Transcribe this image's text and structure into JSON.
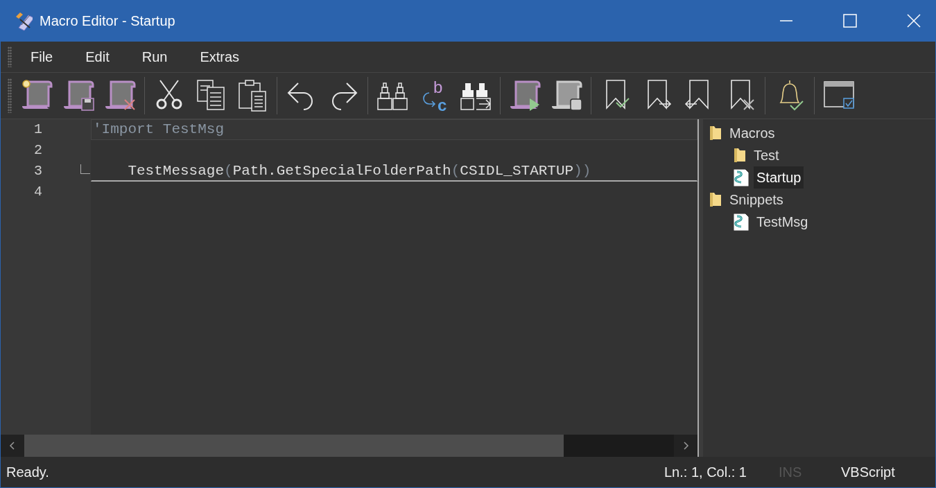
{
  "window": {
    "title": "Macro Editor - Startup"
  },
  "menu": [
    "File",
    "Edit",
    "Run",
    "Extras"
  ],
  "toolbar": {
    "replace_glyphs": [
      "b",
      "c"
    ]
  },
  "editor": {
    "lines": [
      {
        "number": "1",
        "current": true,
        "fold_end": false,
        "tokens": [
          {
            "text": "'Import TestMsg",
            "kind": "comment"
          }
        ]
      },
      {
        "number": "2",
        "current": false,
        "fold_end": false
      },
      {
        "number": "3",
        "current": false,
        "fold_end": true,
        "tokens": [
          {
            "text": "    TestMessage",
            "kind": "ident"
          },
          {
            "text": "(",
            "kind": "paren"
          },
          {
            "text": "Path.GetSpecialFolderPath",
            "kind": "ident"
          },
          {
            "text": "(",
            "kind": "paren"
          },
          {
            "text": "CSIDL_STARTUP",
            "kind": "ident"
          },
          {
            "text": "))",
            "kind": "paren"
          }
        ]
      },
      {
        "number": "4",
        "current": false,
        "fold_end": false
      }
    ]
  },
  "tree": [
    {
      "label": "Macros",
      "kind": "folder",
      "selected": false,
      "children": [
        {
          "label": "Test",
          "kind": "folder",
          "selected": false
        },
        {
          "label": "Startup",
          "kind": "script",
          "selected": true
        }
      ]
    },
    {
      "label": "Snippets",
      "kind": "folder",
      "selected": false,
      "children": [
        {
          "label": "TestMsg",
          "kind": "script",
          "selected": false
        }
      ]
    }
  ],
  "status_bar": {
    "message": "Ready.",
    "position": "Ln.: 1, Col.: 1",
    "mode": {
      "text": "INS",
      "disabled": true
    },
    "language": "VBScript"
  }
}
